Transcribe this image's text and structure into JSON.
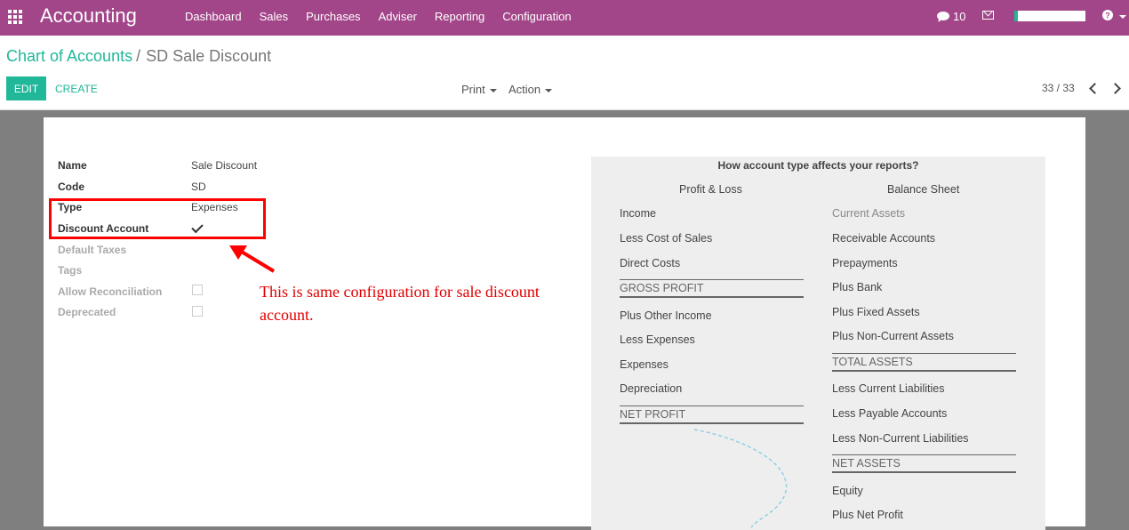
{
  "topbar": {
    "app_title": "Accounting",
    "menu": [
      "Dashboard",
      "Sales",
      "Purchases",
      "Adviser",
      "Reporting",
      "Configuration"
    ],
    "chat_count": "10",
    "brand_color": "#a24689"
  },
  "breadcrumb": {
    "parent": "Chart of Accounts",
    "separator": "/",
    "current": "SD Sale Discount"
  },
  "buttons": {
    "edit": "EDIT",
    "create": "CREATE",
    "print": "Print",
    "action": "Action"
  },
  "pager": {
    "value": "33 / 33"
  },
  "form": {
    "name_label": "Name",
    "name_value": "Sale Discount",
    "code_label": "Code",
    "code_value": "SD",
    "type_label": "Type",
    "type_value": "Expenses",
    "discount_label": "Discount Account",
    "discount_checked": true,
    "taxes_label": "Default Taxes",
    "tags_label": "Tags",
    "reconcile_label": "Allow Reconciliation",
    "reconcile_checked": false,
    "deprecated_label": "Deprecated",
    "deprecated_checked": false
  },
  "annotation": "This is same configuration for sale discount account.",
  "info": {
    "title": "How account type affects your reports?",
    "pl_head": "Profit & Loss",
    "bs_head": "Balance Sheet",
    "pl": {
      "income": "Income",
      "cost_of_sales": "Less Cost of Sales",
      "direct_costs": "Direct Costs",
      "gross_profit": "GROSS PROFIT",
      "other_income": "Plus Other Income",
      "less_expenses": "Less Expenses",
      "expenses": "Expenses",
      "depreciation": "Depreciation",
      "net_profit": "NET PROFIT"
    },
    "bs": {
      "current_assets": "Current Assets",
      "receivable": "Receivable Accounts",
      "prepayments": "Prepayments",
      "bank": "Plus Bank",
      "fixed_assets": "Plus Fixed Assets",
      "noncurrent_assets": "Plus Non-Current Assets",
      "total_assets": "TOTAL ASSETS",
      "current_liab": "Less Current Liabilities",
      "payable": "Less Payable Accounts",
      "noncurrent_liab": "Less Non-Current Liabilities",
      "net_assets": "NET ASSETS",
      "equity": "Equity",
      "net_profit": "Plus Net Profit"
    }
  }
}
